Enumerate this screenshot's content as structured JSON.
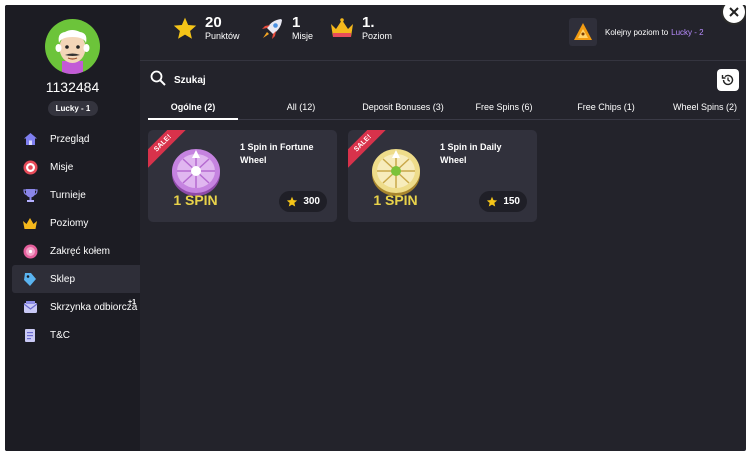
{
  "user": {
    "id": "1132484",
    "level_badge": "Lucky - 1"
  },
  "nav": {
    "items": [
      {
        "label": "Przegląd",
        "icon": "home-icon"
      },
      {
        "label": "Misje",
        "icon": "target-icon"
      },
      {
        "label": "Turnieje",
        "icon": "trophy-icon"
      },
      {
        "label": "Poziomy",
        "icon": "crown-icon"
      },
      {
        "label": "Zakręć kołem",
        "icon": "wheel-icon"
      },
      {
        "label": "Sklep",
        "icon": "tag-icon"
      },
      {
        "label": "Skrzynka odbiorcza",
        "icon": "inbox-icon",
        "badge": "+1"
      },
      {
        "label": "T&C",
        "icon": "document-icon"
      }
    ],
    "active_index": 5
  },
  "stats": {
    "points": {
      "value": "20",
      "label": "Punktów",
      "icon": "star-icon"
    },
    "missions": {
      "value": "1",
      "label": "Misje",
      "icon": "rocket-icon"
    },
    "level": {
      "value": "1.",
      "label": "Poziom",
      "icon": "crown-icon"
    }
  },
  "next_level": {
    "text": "Kolejny poziom to",
    "level_name": "Lucky - 2"
  },
  "search": {
    "placeholder": "Szukaj"
  },
  "tabs": [
    {
      "label": "Ogólne (2)"
    },
    {
      "label": "All (12)"
    },
    {
      "label": "Deposit Bonuses (3)"
    },
    {
      "label": "Free Spins (6)"
    },
    {
      "label": "Free Chips (1)"
    },
    {
      "label": "Wheel Spins (2)"
    }
  ],
  "active_tab": 0,
  "products": [
    {
      "ribbon": "SALE!",
      "title": "1 Spin in Fortune Wheel",
      "spin_label": "1 SPIN",
      "price": "300",
      "wheel_color": "#c583e0",
      "text_color": "#e9d34a"
    },
    {
      "ribbon": "SALE!",
      "title": "1 Spin in Daily Wheel",
      "spin_label": "1 SPIN",
      "price": "150",
      "wheel_color": "#eedc8a",
      "text_color": "#e9d34a"
    }
  ],
  "colors": {
    "accent": "#b88cff",
    "sale_ribbon": "#d8324b",
    "star": "#f5c518"
  }
}
